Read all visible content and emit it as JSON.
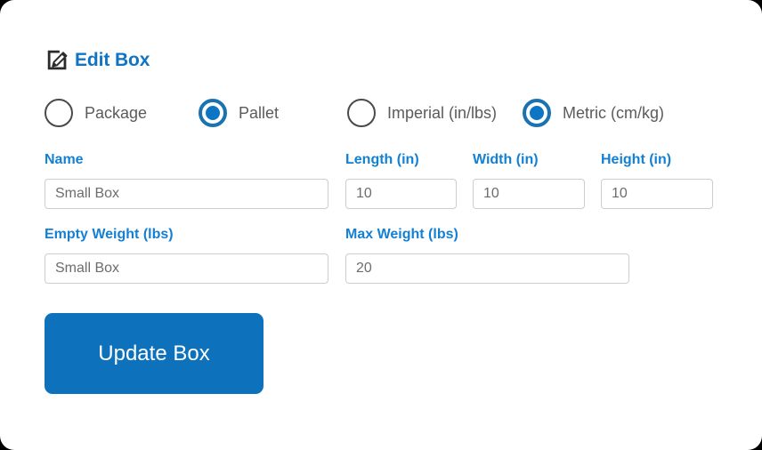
{
  "header": {
    "title": "Edit Box",
    "icon": "edit-pencil-square-icon"
  },
  "type_options": {
    "group_name": "box-type",
    "options": [
      {
        "label": "Package",
        "value": "package",
        "selected": false
      },
      {
        "label": "Pallet",
        "value": "pallet",
        "selected": true
      }
    ]
  },
  "unit_options": {
    "group_name": "unit-system",
    "options": [
      {
        "label": "Imperial (in/lbs)",
        "value": "imperial",
        "selected": false
      },
      {
        "label": "Metric (cm/kg)",
        "value": "metric",
        "selected": true
      }
    ]
  },
  "fields": {
    "name": {
      "label": "Name",
      "value": "Small Box",
      "placeholder": "Small Box"
    },
    "length": {
      "label": "Length (in)",
      "value": "10",
      "placeholder": "10"
    },
    "width": {
      "label": "Width (in)",
      "value": "10",
      "placeholder": "10"
    },
    "height": {
      "label": "Height (in)",
      "value": "10",
      "placeholder": "10"
    },
    "empty_weight": {
      "label": "Empty Weight (lbs)",
      "value": "Small Box",
      "placeholder": "Small Box"
    },
    "max_weight": {
      "label": "Max Weight (lbs)",
      "value": "20",
      "placeholder": "20"
    }
  },
  "actions": {
    "submit_label": "Update Box"
  },
  "colors": {
    "title_blue": "#1173c4",
    "label_blue": "#1480d4",
    "radio_selected_blue": "#0d76c4",
    "radio_ring_blue": "#1b72b0",
    "button_blue": "#0d72bb",
    "input_border": "#cdcdcd",
    "input_text": "#6d6d6d",
    "radio_label_gray": "#5b5b5b",
    "icon_dark": "#262626"
  }
}
